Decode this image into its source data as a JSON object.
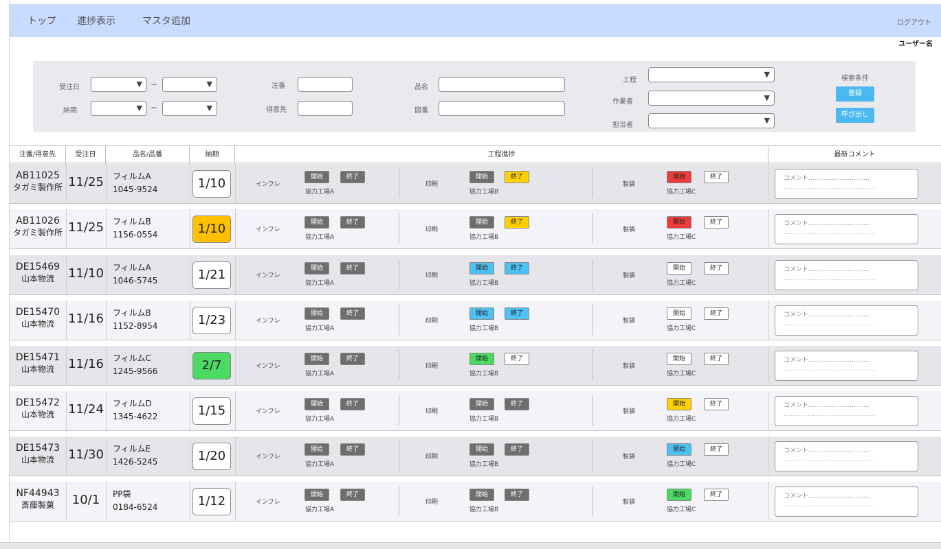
{
  "nav": {
    "items": [
      "トップ",
      "進捗表示",
      "マスタ追加"
    ],
    "logout": "ログアウト",
    "username": "ユーザー名"
  },
  "search": {
    "order_date_label": "受注日",
    "due_label": "納期",
    "tilde": "~",
    "order_no_label": "注番",
    "customer_label": "得意先",
    "product_label": "品名",
    "drawing_label": "図番",
    "process_label": "工程",
    "worker_label": "作業者",
    "manager_label": "担当者",
    "conditions_label": "検索条件",
    "register_button": "登録",
    "recall_button": "呼び出し"
  },
  "table": {
    "headers": [
      "注番/得意先",
      "受注日",
      "品名/品番",
      "納期",
      "工程進捗",
      "最新コメント"
    ],
    "processes": [
      "インフレ",
      "印刷",
      "製袋"
    ],
    "start_label": "開始",
    "end_label": "終了",
    "factories": [
      "協力工場A",
      "協力工場B",
      "協力工場C"
    ],
    "comment_placeholder": "コメント...............................",
    "comment_dots": "......................................",
    "rows": [
      {
        "code": "AB11025",
        "customer": "タガミ製作所",
        "order_date": "11/25",
        "product": "フィルムA",
        "part_no": "1045-9524",
        "due": "1/10",
        "due_color": "#ffffff",
        "states": [
          "gray",
          "gray",
          "gray",
          "yellow",
          "red",
          "white"
        ]
      },
      {
        "code": "AB11026",
        "customer": "タガミ製作所",
        "order_date": "11/25",
        "product": "フィルムB",
        "part_no": "1156-0554",
        "due": "1/10",
        "due_color": "#ffc000",
        "states": [
          "gray",
          "gray",
          "gray",
          "yellow",
          "red",
          "white"
        ]
      },
      {
        "code": "DE15469",
        "customer": "山本物流",
        "order_date": "11/10",
        "product": "フィルムA",
        "part_no": "1046-5745",
        "due": "1/21",
        "due_color": "#ffffff",
        "states": [
          "gray",
          "gray",
          "blue",
          "blue",
          "white",
          "white"
        ]
      },
      {
        "code": "DE15470",
        "customer": "山本物流",
        "order_date": "11/16",
        "product": "フィルムB",
        "part_no": "1152-8954",
        "due": "1/23",
        "due_color": "#ffffff",
        "states": [
          "gray",
          "gray",
          "blue",
          "blue",
          "white",
          "white"
        ]
      },
      {
        "code": "DE15471",
        "customer": "山本物流",
        "order_date": "11/16",
        "product": "フィルムC",
        "part_no": "1245-9566",
        "due": "2/7",
        "due_color": "#4cd964",
        "states": [
          "gray",
          "gray",
          "green",
          "white",
          "white",
          "white"
        ]
      },
      {
        "code": "DE15472",
        "customer": "山本物流",
        "order_date": "11/24",
        "product": "フィルムD",
        "part_no": "1345-4622",
        "due": "1/15",
        "due_color": "#ffffff",
        "states": [
          "gray",
          "gray",
          "gray",
          "gray",
          "yellow",
          "white"
        ]
      },
      {
        "code": "DE15473",
        "customer": "山本物流",
        "order_date": "11/30",
        "product": "フィルムE",
        "part_no": "1426-5245",
        "due": "1/20",
        "due_color": "#ffffff",
        "states": [
          "gray",
          "gray",
          "gray",
          "gray",
          "blue",
          "white"
        ]
      },
      {
        "code": "NF44943",
        "customer": "斎藤製菓",
        "order_date": "10/1",
        "product": "PP袋",
        "part_no": "0184-6524",
        "due": "1/12",
        "due_color": "#ffffff",
        "states": [
          "gray",
          "gray",
          "gray",
          "gray",
          "green",
          "white"
        ]
      }
    ]
  },
  "colors": {
    "gray": "#6e6e6e",
    "yellow": "#ffd000",
    "red": "#ef3b3b",
    "blue": "#4fc0f2",
    "green": "#4cd964",
    "white": "#ffffff",
    "nav_bg": "#c8dcff",
    "accent": "#4cb8f0"
  }
}
